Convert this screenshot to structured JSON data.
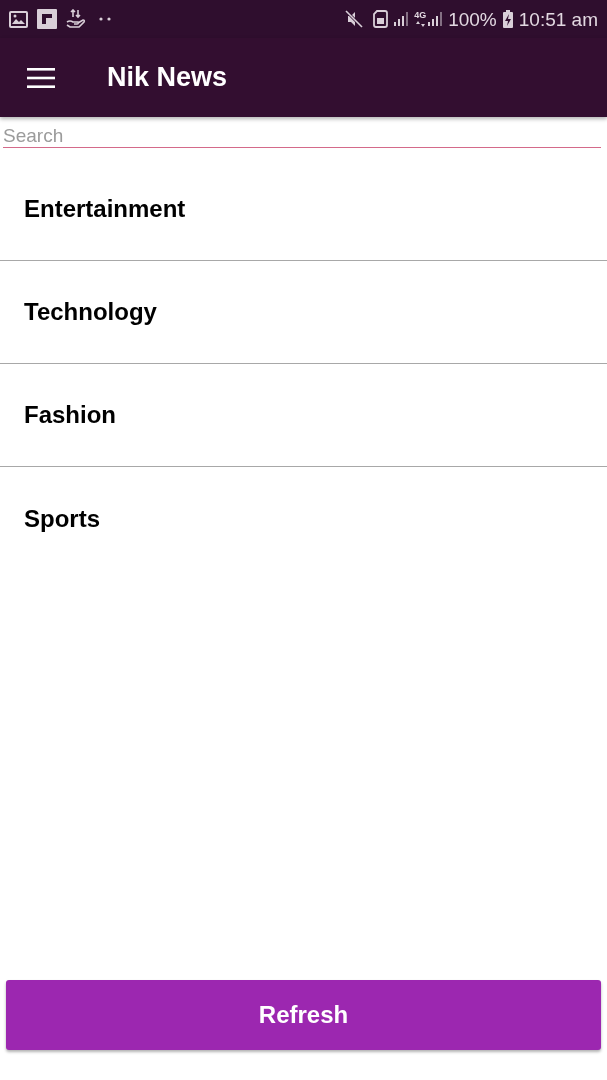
{
  "status_bar": {
    "network": "4G",
    "battery": "100%",
    "time": "10:51 am"
  },
  "app_bar": {
    "title": "Nik News"
  },
  "search": {
    "placeholder": "Search"
  },
  "categories": [
    {
      "label": "Entertainment"
    },
    {
      "label": "Technology"
    },
    {
      "label": "Fashion"
    },
    {
      "label": "Sports"
    }
  ],
  "refresh_button": {
    "label": "Refresh"
  }
}
